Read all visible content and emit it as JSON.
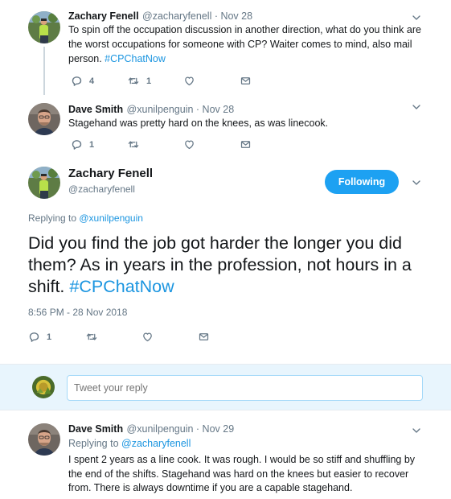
{
  "tweets": [
    {
      "name": "Zachary Fenell",
      "handle": "@zacharyfenell",
      "date": "Nov 28",
      "text_before": "To spin off the occupation discussion in another direction, what do you think are the worst occupations for someone with CP? Waiter comes to mind, also mail person. ",
      "hashtag": "#CPChatNow",
      "replies": "4",
      "retweets": "1"
    },
    {
      "name": "Dave Smith",
      "handle": "@xunilpenguin",
      "date": "Nov 28",
      "text": "Stagehand was pretty hard on the knees, as was linecook.",
      "replies": "1"
    }
  ],
  "main_tweet": {
    "name": "Zachary Fenell",
    "handle": "@zacharyfenell",
    "follow_label": "Following",
    "replying_prefix": "Replying to ",
    "replying_to": "@xunilpenguin",
    "text_before": "Did you find the job got harder the longer you did them? As in years in the profession, not hours in a shift. ",
    "hashtag": "#CPChatNow",
    "timestamp": "8:56 PM - 28 Nov 2018",
    "replies": "1"
  },
  "compose": {
    "placeholder": "Tweet your reply"
  },
  "reply": {
    "name": "Dave Smith",
    "handle": "@xunilpenguin",
    "date": "Nov 29",
    "replying_prefix": "Replying to ",
    "replying_to": "@zacharyfenell",
    "text": "I spent 2 years as a line cook. It was rough. I would be so stiff and shuffling by the end of the shifts. Stagehand was hard on the knees but easier to recover from. There is always downtime if you are a capable stagehand."
  },
  "separator": " · ",
  "colors": {
    "accent": "#1da1f2",
    "link": "#1b95e0",
    "muted": "#657786"
  },
  "icons": [
    "reply-icon",
    "retweet-icon",
    "like-icon",
    "message-icon",
    "chevron-down-icon"
  ]
}
